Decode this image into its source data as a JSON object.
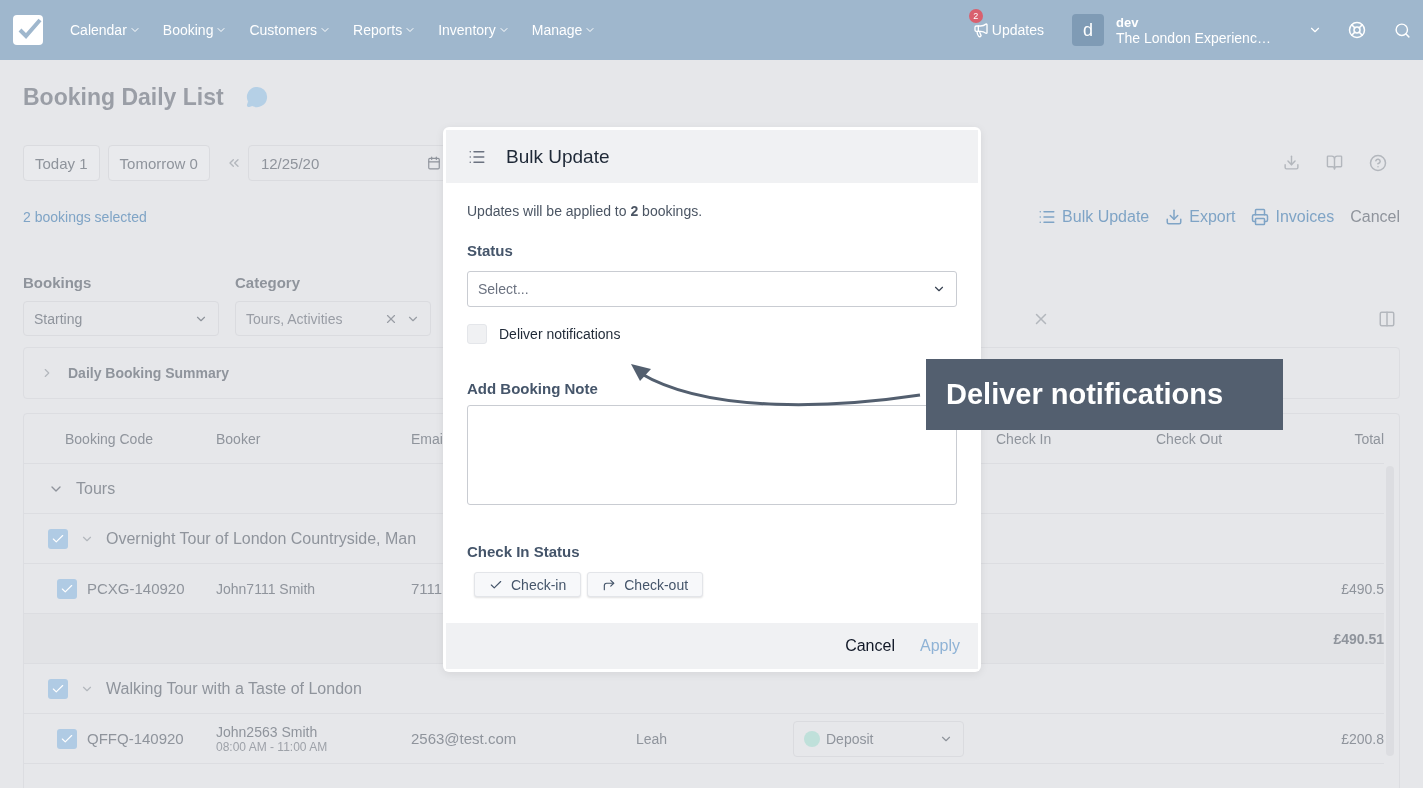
{
  "nav": {
    "menu": [
      {
        "label": "Calendar"
      },
      {
        "label": "Booking"
      },
      {
        "label": "Customers"
      },
      {
        "label": "Reports"
      },
      {
        "label": "Inventory"
      },
      {
        "label": "Manage"
      }
    ],
    "updates": {
      "label": "Updates",
      "badge": "2"
    },
    "user": {
      "avatar": "d",
      "name": "dev",
      "org": "The London Experienc…"
    }
  },
  "page": {
    "title": "Booking Daily List"
  },
  "toolbar": {
    "quick_buttons": [
      "Today 1",
      "Tomorrow 0"
    ],
    "date": "12/25/20"
  },
  "selection": {
    "text": "2 bookings selected",
    "actions": [
      {
        "kind": "list",
        "label": "Bulk Update"
      },
      {
        "kind": "download",
        "label": "Export"
      },
      {
        "kind": "print",
        "label": "Invoices"
      },
      {
        "kind": "plain",
        "label": "Cancel"
      }
    ]
  },
  "filters": [
    {
      "label": "Bookings",
      "value": "Starting",
      "clearable": false
    },
    {
      "label": "Category",
      "value": "Tours, Activities",
      "clearable": true
    }
  ],
  "summary": {
    "title": "Daily Booking Summary",
    "expanded": false
  },
  "table": {
    "columns": {
      "code": "Booking Code",
      "booker": "Booker",
      "email": "Emai",
      "check_in": "Check In",
      "check_out": "Check Out",
      "total": "Total"
    },
    "groups": [
      {
        "name": "Tours",
        "expanded": true,
        "products": [
          {
            "name": "Overnight Tour of London Countryside, Man",
            "checked": true,
            "bookings": [
              {
                "code": "PCXG-140920",
                "booker": "John7111 Smith",
                "email": "7111",
                "total": "£490.5",
                "checked": true
              }
            ],
            "subtotal": "£490.51"
          },
          {
            "name": "Walking Tour with a Taste of London",
            "checked": true,
            "bookings": [
              {
                "code": "QFFQ-140920",
                "booker": "John2563 Smith",
                "time": "08:00 AM - 11:00 AM",
                "email": "2563@test.com",
                "guide": "Leah",
                "status": "Deposit",
                "total": "£200.8",
                "checked": true
              }
            ]
          }
        ]
      }
    ]
  },
  "modal": {
    "title": "Bulk Update",
    "intro": "Updates will be applied to **2** bookings.",
    "status": {
      "label": "Status",
      "placeholder": "Select..."
    },
    "notify": {
      "label": "Deliver notifications",
      "checked": false
    },
    "note": {
      "label": "Add Booking Note"
    },
    "check_in": {
      "label": "Check In Status",
      "buttons": [
        {
          "kind": "check",
          "label": "Check-in"
        },
        {
          "kind": "out",
          "label": "Check-out"
        }
      ]
    },
    "footer": {
      "cancel": "Cancel",
      "apply": {
        "label": "Apply",
        "disabled": true
      }
    }
  },
  "callout": {
    "text": "Deliver notifications"
  }
}
